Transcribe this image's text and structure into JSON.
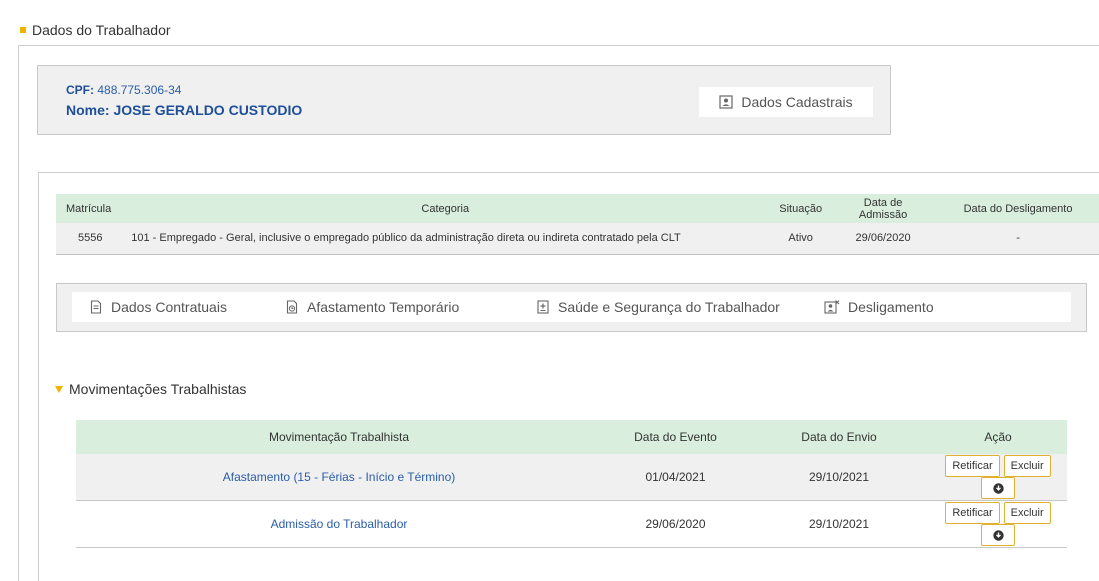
{
  "section": {
    "title": "Dados do Trabalhador"
  },
  "worker": {
    "cpf_label": "CPF:",
    "cpf_value": "488.775.306-34",
    "nome_label": "Nome:",
    "nome_value": "JOSE GERALDO CUSTODIO",
    "cadastrais_button": "Dados Cadastrais"
  },
  "matricula_table": {
    "headers": [
      "Matrícula",
      "Categoria",
      "Situação",
      "Data de Admissão",
      "Data do Desligamento"
    ],
    "rows": [
      [
        "5556",
        "101 - Empregado - Geral, inclusive o empregado público da administração direta ou indireta contratado pela CLT",
        "Ativo",
        "29/06/2020",
        "-"
      ]
    ]
  },
  "tabs": [
    {
      "label": "Dados Contratuais",
      "icon": "document-icon"
    },
    {
      "label": "Afastamento Temporário",
      "icon": "document-clock-icon"
    },
    {
      "label": "Saúde e Segurança do Trabalhador",
      "icon": "medical-document-icon"
    },
    {
      "label": "Desligamento",
      "icon": "user-remove-icon"
    }
  ],
  "movimentacoes": {
    "title": "Movimentações Trabalhistas",
    "headers": [
      "Movimentação Trabalhista",
      "Data do Evento",
      "Data do Envio",
      "Ação"
    ],
    "rows": [
      {
        "name": "Afastamento (15 - Férias - Início e Término)",
        "evento": "01/04/2021",
        "envio": "29/10/2021"
      },
      {
        "name": "Admissão do Trabalhador",
        "evento": "29/06/2020",
        "envio": "29/10/2021"
      }
    ],
    "actions": {
      "retificar": "Retificar",
      "excluir": "Excluir",
      "download_icon": "download-icon"
    }
  },
  "colors": {
    "accent": "#f0b400",
    "header_green": "#d9eedc",
    "link_blue": "#2a5ea8",
    "panel_gray": "#f0f0f0"
  }
}
